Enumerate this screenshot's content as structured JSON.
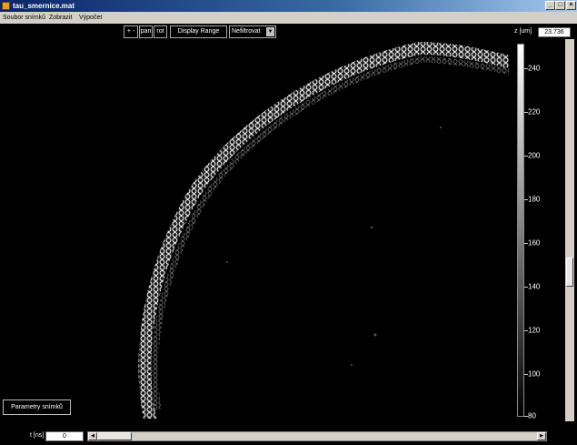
{
  "window": {
    "title": "tau_smernice.mat"
  },
  "menu": [
    "Soubor snímků",
    "Zobrazit",
    "Výpočet"
  ],
  "toolbar": {
    "zoom_label": "+ -",
    "pan_label": "pan",
    "rot_label": "rot",
    "display_range_label": "Display Range",
    "filter_selected": "Nefiltrovat"
  },
  "z": {
    "label": "z [um]",
    "value": "23.736"
  },
  "colorbar": {
    "ticks": [
      "240",
      "220",
      "200",
      "180",
      "160",
      "140",
      "120",
      "100",
      "80"
    ],
    "min": 80,
    "max": 250
  },
  "parameters_button": "Parametry snímků",
  "time": {
    "label": "t [ns]",
    "value": "0"
  },
  "colors": {
    "background": "#000000",
    "title_start": "#0a246a",
    "title_end": "#a6caf0"
  },
  "icons": [
    "app-icon",
    "minimize-icon",
    "maximize-icon",
    "close-icon",
    "dropdown-arrow-icon",
    "scroll-left-icon",
    "scroll-right-icon"
  ]
}
